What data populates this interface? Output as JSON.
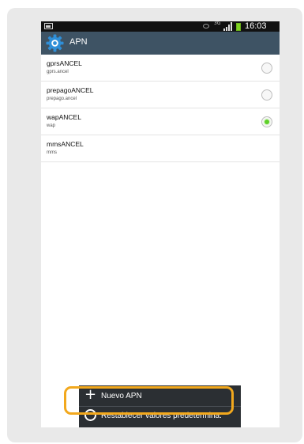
{
  "status_bar": {
    "network": "3G",
    "time": "16:03",
    "icons": [
      "picture-icon",
      "eye-icon",
      "network-3g-icon",
      "signal-icon",
      "battery-icon"
    ]
  },
  "action_bar": {
    "title": "APN",
    "icon": "settings-gear-icon"
  },
  "apn_list": [
    {
      "name": "gprsANCEL",
      "apn": "gprs.ancel",
      "selected": false
    },
    {
      "name": "prepagoANCEL",
      "apn": "prepago.ancel",
      "selected": false
    },
    {
      "name": "wapANCEL",
      "apn": "wap",
      "selected": true
    },
    {
      "name": "mmsANCEL",
      "apn": "mms",
      "selected": null
    }
  ],
  "menu": {
    "items": [
      {
        "label": "Nuevo APN",
        "icon": "plus-icon"
      },
      {
        "label": "Restablecer valores predetermina.",
        "icon": "reset-icon"
      }
    ],
    "highlight_color": "#f2a81d"
  },
  "colors": {
    "action_bar": "#3e5364",
    "selected_radio": "#5fd02a"
  }
}
